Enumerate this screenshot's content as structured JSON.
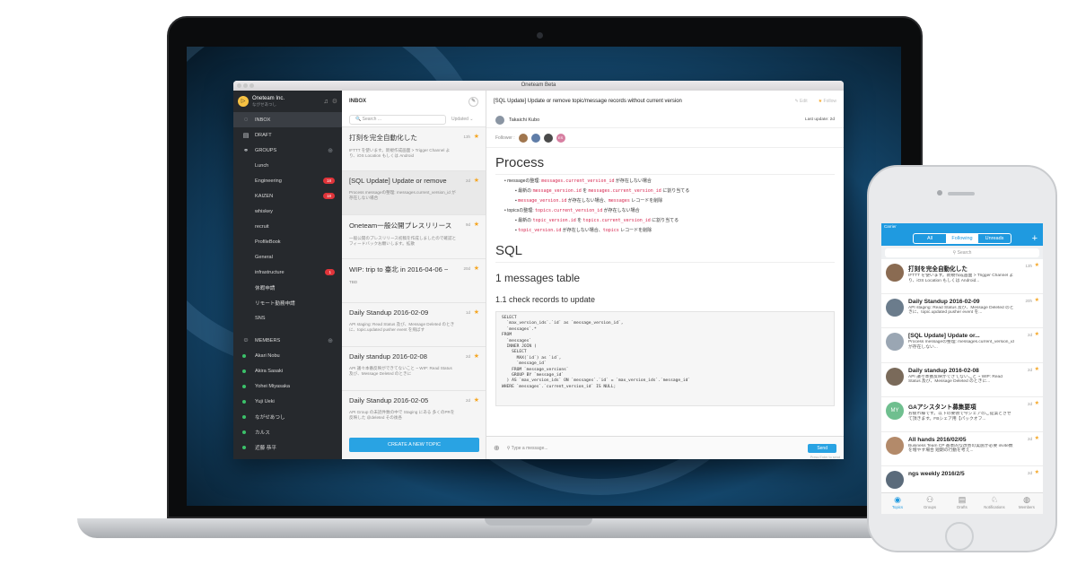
{
  "window": {
    "title": "Oneteam Beta"
  },
  "team": {
    "name": "Oneteam Inc.",
    "user": "ながせあつし",
    "logo_glyph": "▷",
    "bell_icon": "bell-icon",
    "gear_icon": "gear-icon"
  },
  "sidebar": {
    "inbox": "INBOX",
    "draft": "DRAFT",
    "groups": "GROUPS",
    "group_items": [
      {
        "label": "Lunch",
        "badge": ""
      },
      {
        "label": "Engineering",
        "badge": "18"
      },
      {
        "label": "KAIZEN",
        "badge": "18"
      },
      {
        "label": "whiskey",
        "badge": ""
      },
      {
        "label": "recruit",
        "badge": ""
      },
      {
        "label": "ProfileBook",
        "badge": ""
      },
      {
        "label": "General",
        "badge": ""
      },
      {
        "label": "infrastructure",
        "badge": "1"
      },
      {
        "label": "休暇申請",
        "badge": ""
      },
      {
        "label": "リモート勤務申請",
        "badge": ""
      },
      {
        "label": "SNS",
        "badge": ""
      }
    ],
    "members": "MEMBERS",
    "member_items": [
      "Akari Nobu",
      "Akira Sasaki",
      "Yohei Miyasaka",
      "Yuji Ueki",
      "ながせあつし",
      "カルス",
      "近藤 恭平"
    ]
  },
  "inbox": {
    "title": "INBOX",
    "search_placeholder": "Search ...",
    "sort": "Updated",
    "items": [
      {
        "title": "打刻を完全自動化した",
        "snippet": "IFTTT を使います。新規作成画面 > Trigger Channel より、iOS Location もしくは Android",
        "time": "13h"
      },
      {
        "title": "[SQL Update] Update or remove",
        "snippet": "Process messageの整理: messages.current_version_id が存在しない場合",
        "time": "2d"
      },
      {
        "title": "Oneteam一般公開プレスリリース",
        "snippet": "一般公開のプレスリリース初稿を作成しましたので確認とフィードバックお願いします。拡散",
        "time": "9d"
      },
      {
        "title": "WIP: trip to 臺北 in 2016-04-06 ~",
        "snippet": "TBD",
        "time": "20d"
      },
      {
        "title": "Daily Standup 2016-02-09",
        "snippet": "API staging: Read Status 及び、Message Deleted のときに、topic.updated pusher event を飛ばす",
        "time": "1d"
      },
      {
        "title": "Daily standup 2016-02-08",
        "snippet": "API 議々本番反映ができてないこと ~ WIP: Read Status 及び、Message Deleted のときに",
        "time": "2d"
      },
      {
        "title": "Daily Standup 2016-02-05",
        "snippet": "API Group の未読件数の中で Staging にある 多くのPRを反映した @deleted その後各",
        "time": "2d"
      }
    ],
    "create_button": "CREATE A NEW TOPIC"
  },
  "content": {
    "title": "[SQL Update] Update or remove topic/message records without current version",
    "edit": "Edit",
    "follow": "Follow",
    "author": "Takaichi Kubo",
    "last_update": "Last update: 2d",
    "followers_label": "Follower :",
    "follower_initials": "ES",
    "h_process": "Process",
    "b1_pre": "messageの整理: ",
    "b1_code": "messages.current_version_id",
    "b1_post": " が存在しない場合",
    "b1a_pre": "最新の ",
    "b1a_code1": "message_version.id",
    "b1a_mid": " を ",
    "b1a_code2": "messages.current_version_id",
    "b1a_post": " に割り当てる",
    "b1b_code": "message_version.id",
    "b1b_mid": " が存在しない場合、",
    "b1b_code2": "messages",
    "b1b_post": " レコードを削除",
    "b2_pre": "topicsの整理: ",
    "b2_code": "topics.current_version_id",
    "b2_post": " が存在しない場合",
    "b2a_pre": "最新の ",
    "b2a_code1": "topic_version.id",
    "b2a_mid": " を ",
    "b2a_code2": "topics.current_version_id",
    "b2a_post": " に割り当てる",
    "b2b_code": "topic_version.id",
    "b2b_mid": " が存在しない場合、",
    "b2b_code2": "topics",
    "b2b_post": " レコードを削除",
    "h_sql": "SQL",
    "h_table": "1 messages table",
    "h_check": "1.1 check records to update",
    "sql": "SELECT\n  `max_version_ids`.`id` as `message_version_id`,\n  `messages`.*\nFROM\n  `messages`\n  INNER JOIN (\n    SELECT\n      MAX(`id`) as `id`,\n      `message_id`\n    FROM `message_versions`\n    GROUP BY `message_id`\n  ) AS `max_version_ids` ON `messages`.`id` = `max_version_ids`.`message_id`\nWHERE `messages`.`current_version_id` IS NULL;",
    "composer_placeholder": "Type a message...",
    "send": "Send",
    "press_enter": "Press Enter to send"
  },
  "phone": {
    "carrier": "Carrier",
    "segments": [
      "All",
      "Following",
      "Unreads"
    ],
    "search": "Search",
    "items": [
      {
        "title": "打刻を完全自動化した",
        "snippet": "IFTTT を使います。新規作成画面 > Trigger Channel より、iOS Location もしくは Android...",
        "time": "13h",
        "avatar": ""
      },
      {
        "title": "Daily Standup 2016-02-09",
        "snippet": "API staging: Read Status 及び、Message Deleted のときに、topic.updated pusher event を...",
        "time": "20h",
        "avatar": ""
      },
      {
        "title": "[SQL Update] Update or...",
        "snippet": "Process messageの整理: messages.current_version_id が存在しない...",
        "time": "2d",
        "avatar": ""
      },
      {
        "title": "Daily standup 2016-02-08",
        "snippet": "API 議々本番反映ができてないこと ~ WIP: Read Status 及び、Message Deleted のときに...",
        "time": "2d",
        "avatar": ""
      },
      {
        "title": "GAアシスタント募集要項",
        "snippet": "お疲れ様です。以下の要領で今シェアのご提案とさせて頂きます。FBシェア用【パックオフ...",
        "time": "2d",
        "avatar": "MY"
      },
      {
        "title": "All hands 2016/02/05",
        "snippet": "Business Team CP 基本的な改善の実施が必要 invite数を増やす場合 短期の行動を考え...",
        "time": "2d",
        "avatar": ""
      },
      {
        "title": "ngs weekly 2016/2/5",
        "snippet": "",
        "time": "2d",
        "avatar": ""
      }
    ],
    "tabs": [
      "Topics",
      "Groups",
      "Drafts",
      "Notifications",
      "Members"
    ]
  }
}
